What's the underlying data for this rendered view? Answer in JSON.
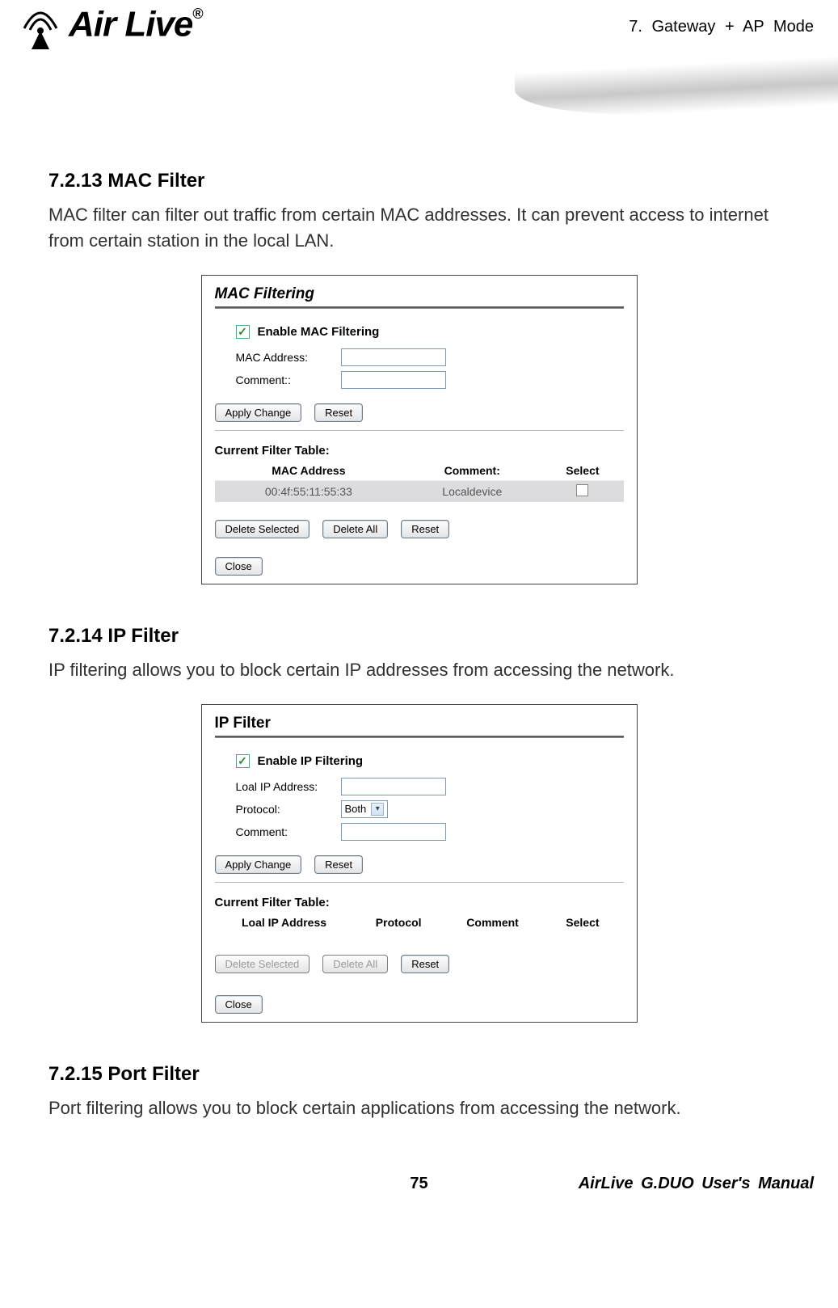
{
  "header": {
    "chapter": "7.  Gateway  +  AP    Mode",
    "logo_text": "Air Live",
    "logo_reg": "®"
  },
  "sections": {
    "mac": {
      "heading": "7.2.13 MAC Filter",
      "body": "MAC filter can filter out traffic from certain MAC addresses.    It can prevent access to internet from certain station in the local LAN."
    },
    "ip": {
      "heading": "7.2.14 IP Filter",
      "body": "IP filtering allows you to block certain IP addresses from accessing the network."
    },
    "port": {
      "heading": "7.2.15 Port Filter",
      "body": "Port filtering allows you to block certain applications from accessing the network."
    }
  },
  "mac_panel": {
    "title": "MAC Filtering",
    "enable_label": "Enable MAC Filtering",
    "fields": {
      "mac_label": "MAC Address:",
      "comment_label": "Comment::"
    },
    "buttons": {
      "apply": "Apply Change",
      "reset": "Reset",
      "delete_selected": "Delete Selected",
      "delete_all": "Delete All",
      "reset2": "Reset",
      "close": "Close"
    },
    "table": {
      "title": "Current Filter Table:",
      "cols": {
        "c1": "MAC Address",
        "c2": "Comment:",
        "c3": "Select"
      },
      "row": {
        "mac": "00:4f:55:11:55:33",
        "comment": "Localdevice"
      }
    }
  },
  "ip_panel": {
    "title": "IP Filter",
    "enable_label": "Enable IP Filtering",
    "fields": {
      "ip_label": "Loal IP Address:",
      "proto_label": "Protocol:",
      "proto_value": "Both",
      "comment_label": "Comment:"
    },
    "buttons": {
      "apply": "Apply Change",
      "reset": "Reset",
      "delete_selected": "Delete Selected",
      "delete_all": "Delete All",
      "reset2": "Reset",
      "close": "Close"
    },
    "table": {
      "title": "Current Filter Table:",
      "cols": {
        "c1": "Loal IP Address",
        "c2": "Protocol",
        "c3": "Comment",
        "c4": "Select"
      }
    }
  },
  "footer": {
    "page": "75",
    "doc": "AirLive  G.DUO  User's  Manual"
  }
}
